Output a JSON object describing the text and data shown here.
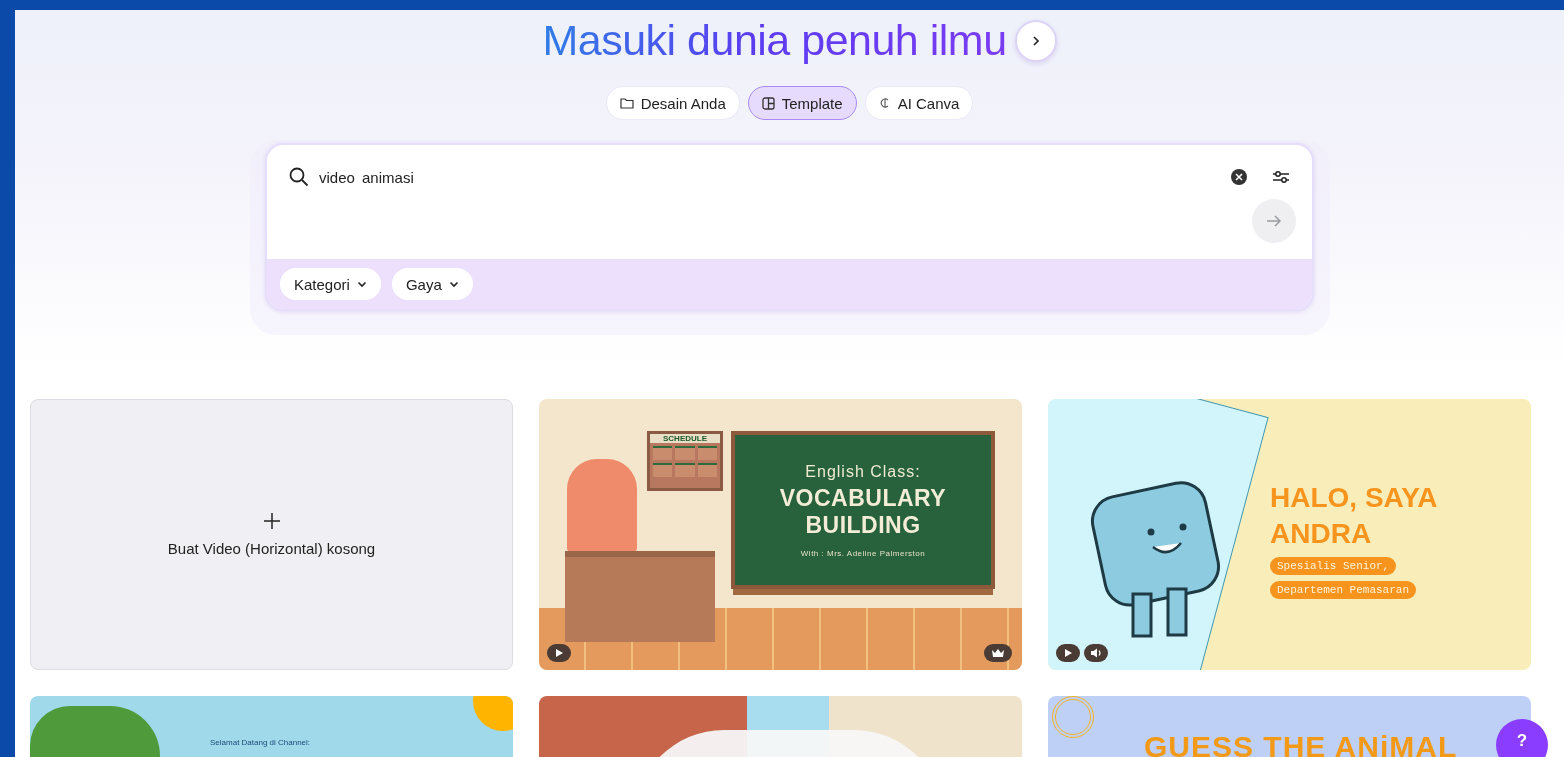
{
  "heading": "Masuki dunia penuh ilmu",
  "tabs": [
    {
      "label": "Desain Anda",
      "selected": false,
      "kind": "folder"
    },
    {
      "label": "Template",
      "selected": true,
      "kind": "template"
    },
    {
      "label": "AI Canva",
      "selected": false,
      "kind": "ai"
    }
  ],
  "search": {
    "value": "video animasi"
  },
  "filters": [
    "Kategori",
    "Gaya"
  ],
  "blank_card": {
    "label": "Buat Video (Horizontal) kosong"
  },
  "templates": [
    {
      "kind": "classroom",
      "board_label": "SCHEDULE",
      "title": "English Class:",
      "headline": "VOCABULARY BUILDING",
      "subtitle": "With : Mrs. Adeline Palmerston",
      "sound": false,
      "premium": true
    },
    {
      "kind": "intro",
      "headline": "HALO, SAYA",
      "headline_2": "ANDRA",
      "tags": [
        "Spesialis Senior,",
        "Departemen Pemasaran"
      ],
      "sound": true,
      "premium": false
    },
    {
      "kind": "nature",
      "title": "Selamat Datang di Channel:"
    },
    {
      "kind": "street"
    },
    {
      "kind": "sky",
      "headline": "GUESS THE ANiMAL"
    }
  ],
  "help": "?"
}
